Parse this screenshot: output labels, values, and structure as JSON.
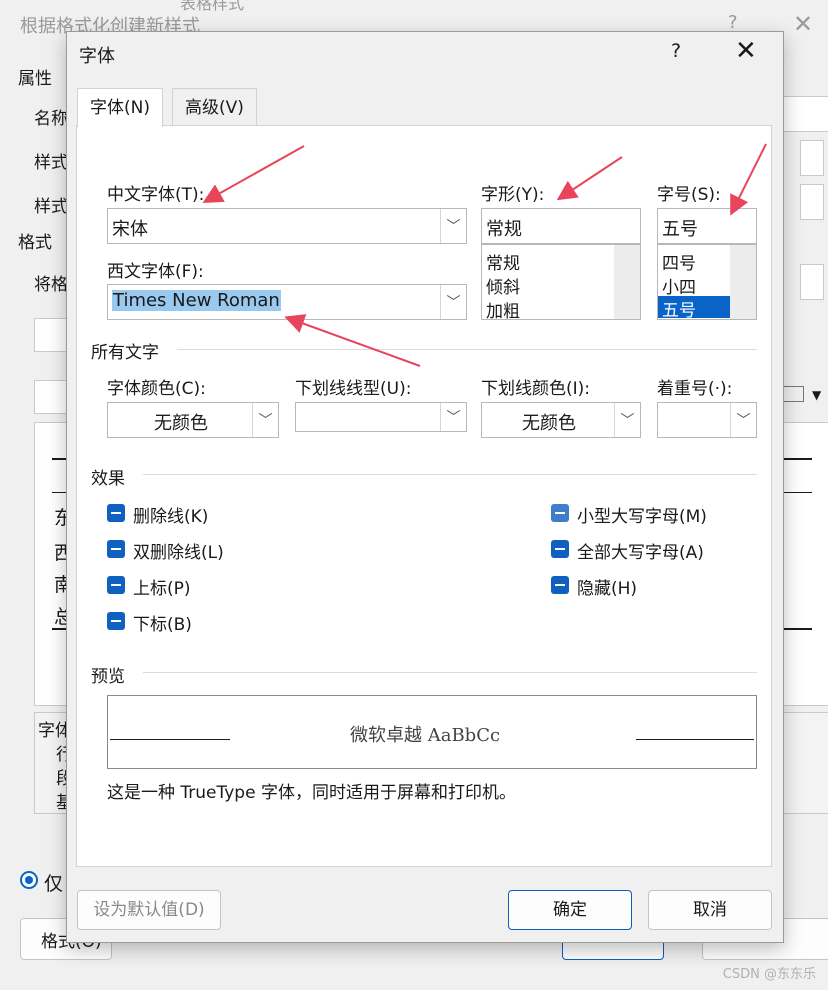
{
  "background_dialog": {
    "title": "根据格式化创建新样式",
    "help": "?",
    "close": "✕",
    "clipped_top": "表格样式",
    "section_properties": "属性",
    "name_label": "名称",
    "style_label_1": "样式",
    "style_label_2": "样式",
    "section_format": "格式",
    "apply_label": "将格",
    "preview_lines": [
      "东",
      "西",
      "南",
      "总"
    ],
    "desc_lines": [
      "字体",
      "行",
      "段",
      "基"
    ],
    "radio_label": "仅",
    "format_button": "格式(O)"
  },
  "dialog": {
    "title": "字体",
    "help": "?",
    "close": "✕",
    "tabs": [
      {
        "label": "字体(N)",
        "active": true
      },
      {
        "label": "高级(V)",
        "active": false
      }
    ],
    "chinese_font": {
      "label": "中文字体(T):",
      "value": "宋体"
    },
    "western_font": {
      "label": "西文字体(F):",
      "value": "Times New Roman"
    },
    "style": {
      "label": "字形(Y):",
      "value": "常规",
      "options": [
        "常规",
        "倾斜",
        "加粗"
      ]
    },
    "size": {
      "label": "字号(S):",
      "value": "五号",
      "options": [
        "四号",
        "小四",
        "五号"
      ],
      "selected": "五号"
    },
    "all_text": {
      "title": "所有文字",
      "font_color_label": "字体颜色(C):",
      "font_color_value": "无颜色",
      "underline_style_label": "下划线线型(U):",
      "underline_style_value": "",
      "underline_color_label": "下划线颜色(I):",
      "underline_color_value": "无颜色",
      "emphasis_label": "着重号(·):",
      "emphasis_value": ""
    },
    "effects": {
      "title": "效果",
      "left": [
        "删除线(K)",
        "双删除线(L)",
        "上标(P)",
        "下标(B)"
      ],
      "right": [
        "小型大写字母(M)",
        "全部大写字母(A)",
        "隐藏(H)"
      ]
    },
    "preview": {
      "title": "预览",
      "sample": "微软卓越  AaBbCc",
      "note": "这是一种 TrueType 字体，同时适用于屏幕和打印机。"
    },
    "buttons": {
      "set_default": "设为默认值(D)",
      "ok": "确定",
      "cancel": "取消"
    }
  },
  "colors": {
    "accent": "#0a64c8",
    "annotation_arrow": "#e8455a"
  },
  "watermark": "CSDN @东东乐"
}
